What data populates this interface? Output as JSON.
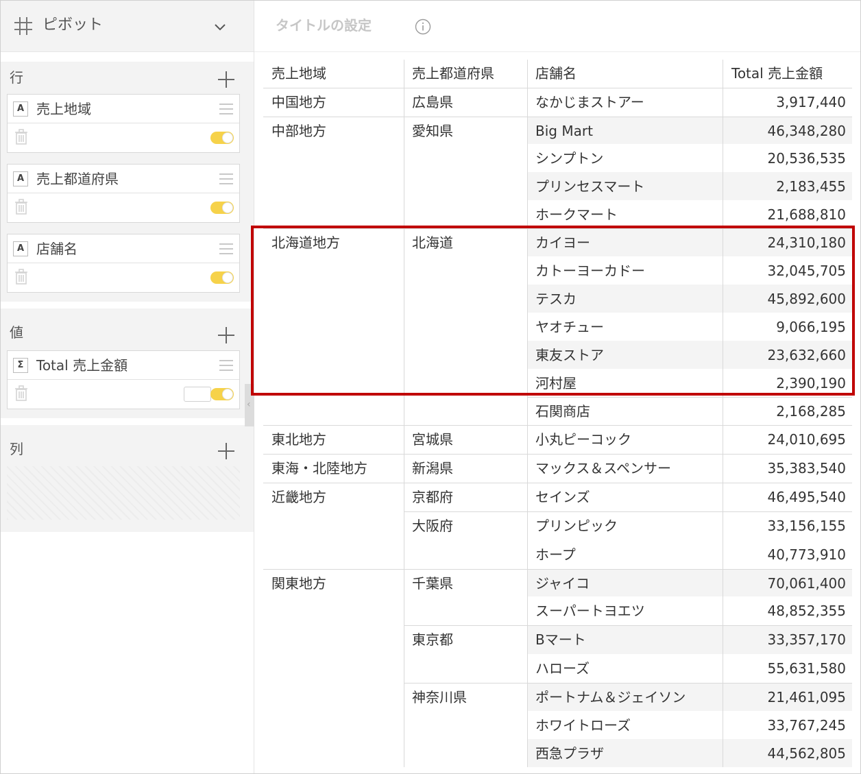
{
  "left_panel": {
    "title": "ピボット",
    "rows_label": "行",
    "values_label": "値",
    "columns_label": "列",
    "row_fields": [
      {
        "type": "A",
        "label": "売上地域"
      },
      {
        "type": "A",
        "label": "売上都道府県"
      },
      {
        "type": "A",
        "label": "店舗名"
      }
    ],
    "value_fields": [
      {
        "type": "Σ",
        "label": "Total 売上金額"
      }
    ]
  },
  "right_panel": {
    "title_placeholder": "タイトルの設定",
    "headers": [
      "売上地域",
      "売上都道府県",
      "店舗名",
      "Total 売上金額"
    ]
  },
  "rows": [
    {
      "region": "中国地方",
      "prefecture": "広島県",
      "store": "なかじまストアー",
      "amount": "3,917,440"
    },
    {
      "region": "中部地方",
      "prefecture": "愛知県",
      "store": "Big Mart",
      "amount": "46,348,280"
    },
    {
      "region": "",
      "prefecture": "",
      "store": "シンプトン",
      "amount": "20,536,535"
    },
    {
      "region": "",
      "prefecture": "",
      "store": "プリンセスマート",
      "amount": "2,183,455"
    },
    {
      "region": "",
      "prefecture": "",
      "store": "ホークマート",
      "amount": "21,688,810"
    },
    {
      "region": "北海道地方",
      "prefecture": "北海道",
      "store": "カイヨー",
      "amount": "24,310,180"
    },
    {
      "region": "",
      "prefecture": "",
      "store": "カトーヨーカドー",
      "amount": "32,045,705"
    },
    {
      "region": "",
      "prefecture": "",
      "store": "テスカ",
      "amount": "45,892,600"
    },
    {
      "region": "",
      "prefecture": "",
      "store": "ヤオチュー",
      "amount": "9,066,195"
    },
    {
      "region": "",
      "prefecture": "",
      "store": "東友ストア",
      "amount": "23,632,660"
    },
    {
      "region": "",
      "prefecture": "",
      "store": "河村屋",
      "amount": "2,390,190"
    },
    {
      "region": "",
      "prefecture": "",
      "store": "石関商店",
      "amount": "2,168,285"
    },
    {
      "region": "東北地方",
      "prefecture": "宮城県",
      "store": "小丸ピーコック",
      "amount": "24,010,695"
    },
    {
      "region": "東海・北陸地方",
      "prefecture": "新潟県",
      "store": "マックス＆スペンサー",
      "amount": "35,383,540"
    },
    {
      "region": "近畿地方",
      "prefecture": "京都府",
      "store": "セインズ",
      "amount": "46,495,540"
    },
    {
      "region": "",
      "prefecture": "大阪府",
      "store": "プリンピック",
      "amount": "33,156,155"
    },
    {
      "region": "",
      "prefecture": "",
      "store": "ホープ",
      "amount": "40,773,910"
    },
    {
      "region": "関東地方",
      "prefecture": "千葉県",
      "store": "ジャイコ",
      "amount": "70,061,400"
    },
    {
      "region": "",
      "prefecture": "",
      "store": "スーパートヨエツ",
      "amount": "48,852,355"
    },
    {
      "region": "",
      "prefecture": "東京都",
      "store": "Bマート",
      "amount": "33,357,170"
    },
    {
      "region": "",
      "prefecture": "",
      "store": "ハローズ",
      "amount": "55,631,580"
    },
    {
      "region": "",
      "prefecture": "神奈川県",
      "store": "ポートナム＆ジェイソン",
      "amount": "21,461,095"
    },
    {
      "region": "",
      "prefecture": "",
      "store": "ホワイトローズ",
      "amount": "33,767,245"
    },
    {
      "region": "",
      "prefecture": "",
      "store": "西急プラザ",
      "amount": "44,562,805"
    }
  ],
  "colors": {
    "highlight": "#c00000",
    "toggle_on": "#f6d24a",
    "panel_bg": "#f3f3f3"
  }
}
